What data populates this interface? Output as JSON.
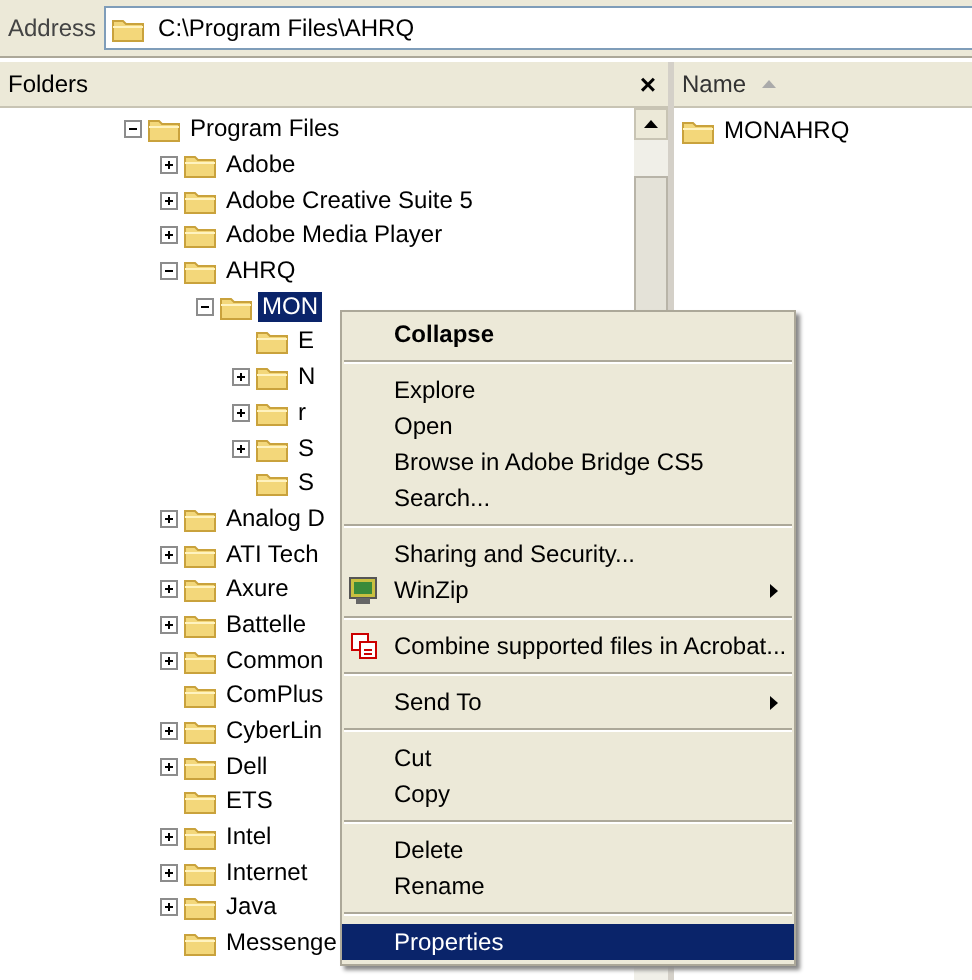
{
  "address_bar": {
    "label": "Address",
    "value": "C:\\Program Files\\AHRQ"
  },
  "folders_pane": {
    "title": "Folders",
    "close": "×",
    "tree": [
      {
        "label": "Program Files",
        "kind": "expanded",
        "selected": false,
        "children": [
          {
            "label": "Adobe",
            "kind": "collapsed",
            "selected": false
          },
          {
            "label": "Adobe Creative Suite 5",
            "kind": "collapsed",
            "selected": false
          },
          {
            "label": "Adobe Media Player",
            "kind": "collapsed",
            "selected": false
          },
          {
            "label": "AHRQ",
            "kind": "expanded",
            "selected": false,
            "children": [
              {
                "label": "MON",
                "kind": "expanded",
                "selected": true,
                "children": [
                  {
                    "label": "E",
                    "kind": "leaf",
                    "selected": false
                  },
                  {
                    "label": "N",
                    "kind": "collapsed",
                    "selected": false
                  },
                  {
                    "label": "r",
                    "kind": "collapsed",
                    "selected": false
                  },
                  {
                    "label": "S",
                    "kind": "collapsed",
                    "selected": false
                  },
                  {
                    "label": "S",
                    "kind": "leaf",
                    "selected": false
                  }
                ]
              }
            ]
          },
          {
            "label": "Analog D",
            "kind": "collapsed",
            "selected": false
          },
          {
            "label": "ATI Tech",
            "kind": "collapsed",
            "selected": false
          },
          {
            "label": "Axure",
            "kind": "collapsed",
            "selected": false
          },
          {
            "label": "Battelle",
            "kind": "collapsed",
            "selected": false
          },
          {
            "label": "Common",
            "kind": "collapsed",
            "selected": false
          },
          {
            "label": "ComPlus",
            "kind": "leaf",
            "selected": false
          },
          {
            "label": "CyberLin",
            "kind": "collapsed",
            "selected": false
          },
          {
            "label": "Dell",
            "kind": "collapsed",
            "selected": false
          },
          {
            "label": "ETS",
            "kind": "leaf",
            "selected": false
          },
          {
            "label": "Intel",
            "kind": "collapsed",
            "selected": false
          },
          {
            "label": "Internet",
            "kind": "collapsed",
            "selected": false
          },
          {
            "label": "Java",
            "kind": "collapsed",
            "selected": false
          },
          {
            "label": "Messenge",
            "kind": "leaf",
            "selected": false
          }
        ]
      }
    ]
  },
  "file_list": {
    "columns": [
      {
        "label": "Name",
        "sorted": true
      }
    ],
    "items": [
      {
        "name": "MONAHRQ"
      }
    ]
  },
  "context_menu": [
    {
      "kind": "item",
      "label": "Collapse",
      "default": true,
      "selected": false
    },
    {
      "kind": "separator"
    },
    {
      "kind": "item",
      "label": "Explore",
      "selected": false
    },
    {
      "kind": "item",
      "label": "Open",
      "selected": false
    },
    {
      "kind": "item",
      "label": "Browse in Adobe Bridge CS5",
      "selected": false
    },
    {
      "kind": "item",
      "label": "Search...",
      "selected": false
    },
    {
      "kind": "separator"
    },
    {
      "kind": "item",
      "label": "Sharing and Security...",
      "selected": false
    },
    {
      "kind": "item",
      "label": "WinZip",
      "submenu": true,
      "selected": false
    },
    {
      "kind": "separator"
    },
    {
      "kind": "item",
      "label": "Combine supported files in Acrobat...",
      "selected": false
    },
    {
      "kind": "separator"
    },
    {
      "kind": "item",
      "label": "Send To",
      "submenu": true,
      "selected": false
    },
    {
      "kind": "separator"
    },
    {
      "kind": "item",
      "label": "Cut",
      "selected": false
    },
    {
      "kind": "item",
      "label": "Copy",
      "selected": false
    },
    {
      "kind": "separator"
    },
    {
      "kind": "item",
      "label": "Delete",
      "selected": false
    },
    {
      "kind": "item",
      "label": "Rename",
      "selected": false
    },
    {
      "kind": "separator"
    },
    {
      "kind": "item",
      "label": "Properties",
      "selected": true
    }
  ]
}
